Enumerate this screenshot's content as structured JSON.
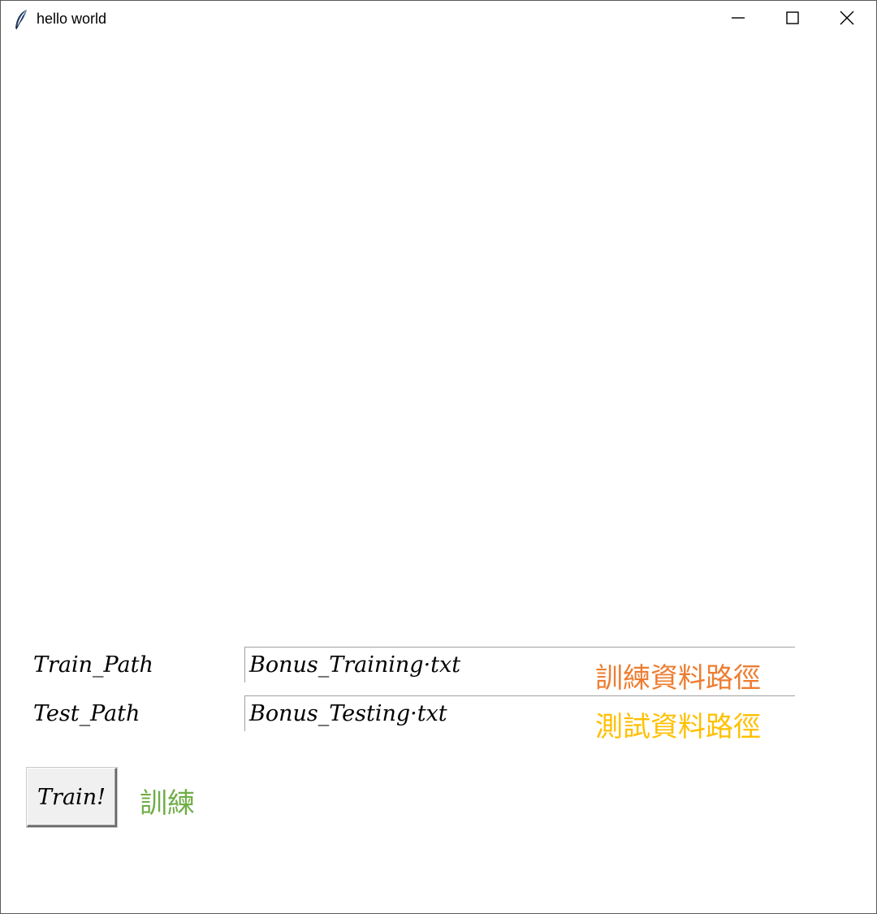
{
  "window": {
    "title": "hello world",
    "icons": {
      "app": "feather-icon",
      "minimize": "minimize-icon",
      "maximize": "maximize-icon",
      "close": "close-icon"
    }
  },
  "form": {
    "train_path": {
      "label": "Train_Path",
      "value": "Bonus_Training·txt",
      "hint": "訓練資料路徑",
      "hint_color": "#ed7d31"
    },
    "test_path": {
      "label": "Test_Path",
      "value": "Bonus_Testing·txt",
      "hint": "測試資料路徑",
      "hint_color": "#ffc000"
    },
    "train_button": {
      "label": "Train!",
      "hint": "訓練",
      "hint_color": "#70ad47"
    }
  }
}
